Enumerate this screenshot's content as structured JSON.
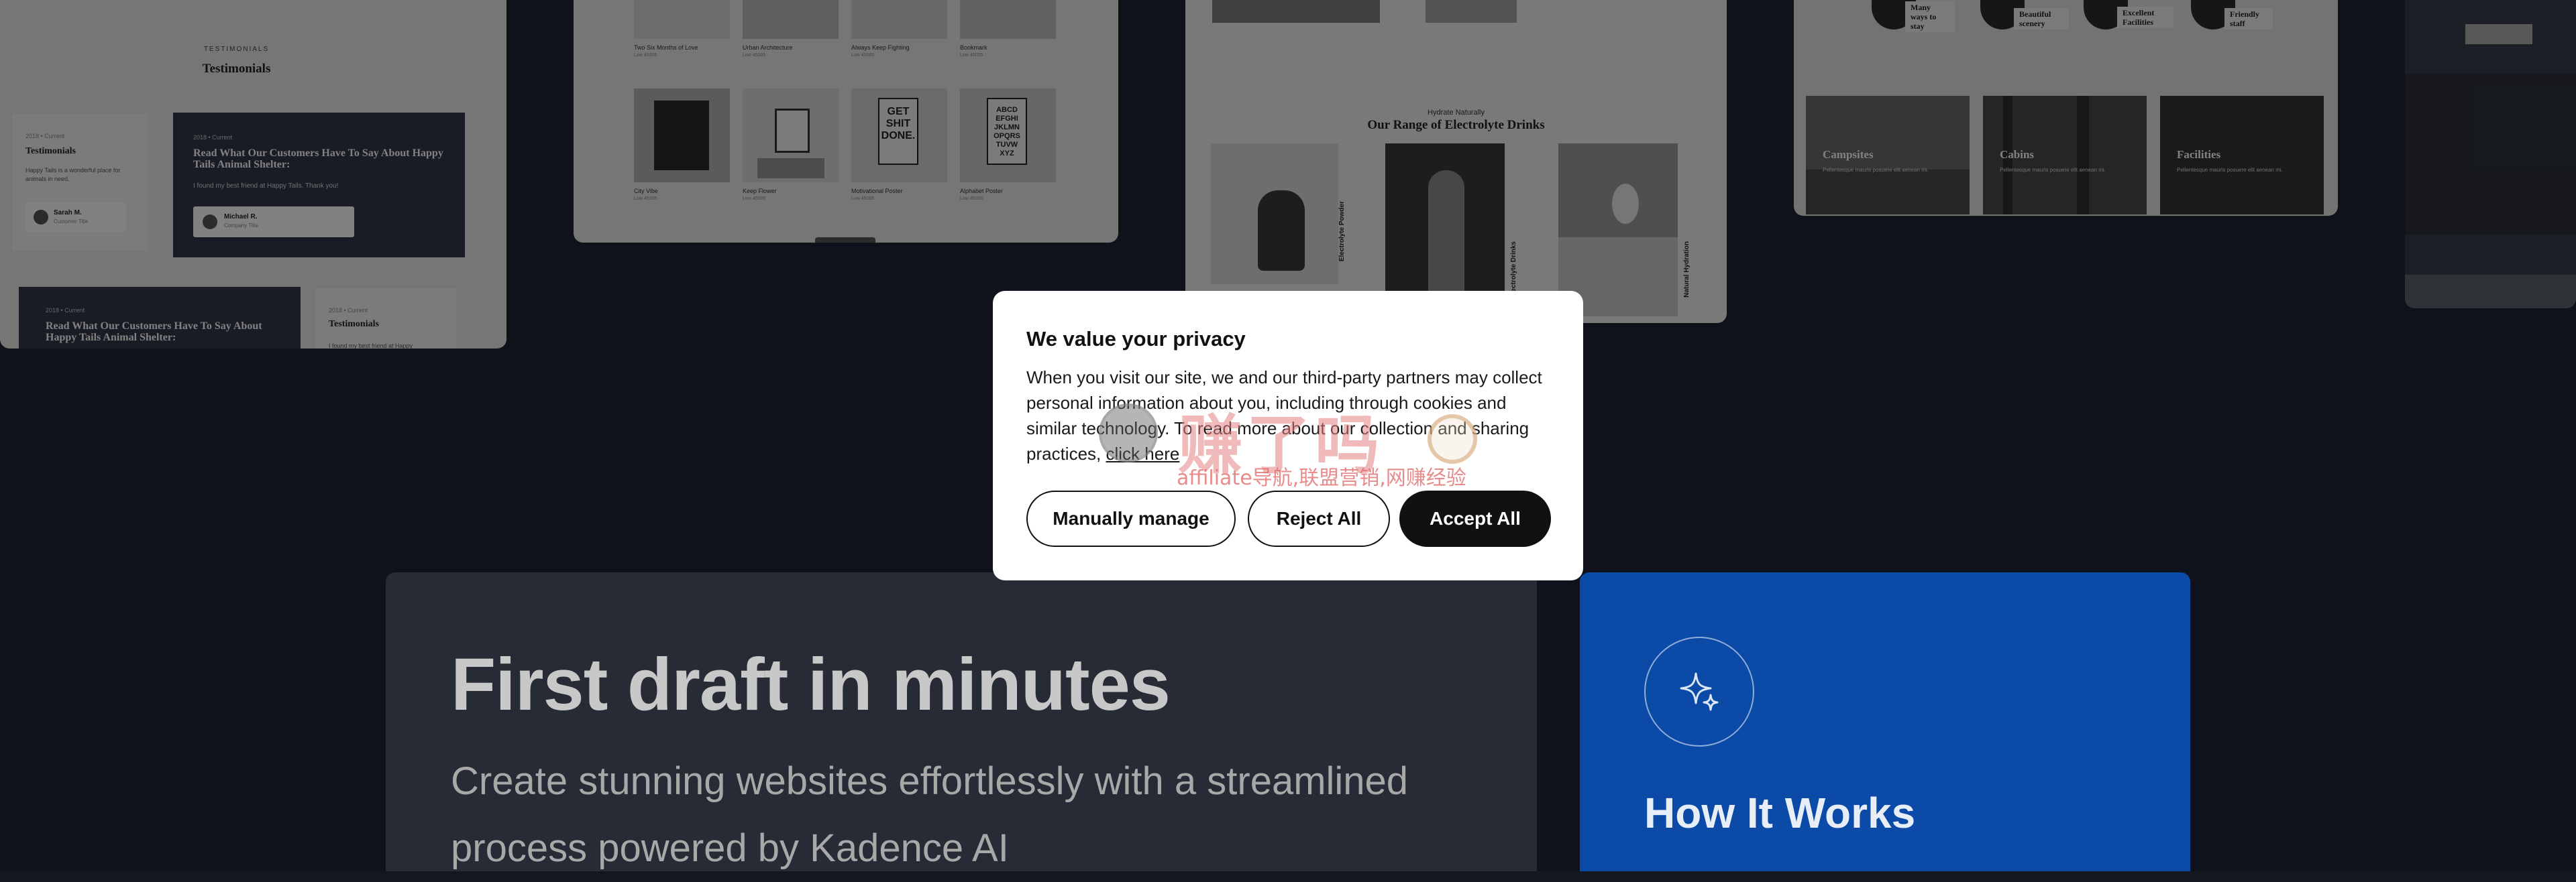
{
  "bg_cards": {
    "testimonials": {
      "eyebrow": "TESTIMONIALS",
      "title": "Testimonials",
      "card_a": {
        "meta": "2018 • Current",
        "heading": "Testimonials",
        "body": "Happy Tails is a wonderful place for animals in need.",
        "author": "Sarah M.",
        "role": "Customer Title"
      },
      "card_b": {
        "meta": "2018 • Current",
        "heading": "Read What Our Customers Have To Say About Happy Tails Animal Shelter:",
        "body": "I found my best friend at Happy Tails. Thank you!",
        "author": "Michael R.",
        "role": "Company Title"
      },
      "card_c": {
        "meta": "2018 • Current",
        "heading": "Read What Our Customers Have To Say About Happy Tails Animal Shelter:"
      },
      "card_d": {
        "meta": "2018 • Current",
        "heading": "Testimonials",
        "body": "I found my best friend at Happy"
      }
    },
    "shop": {
      "top_row": [
        {
          "name": "Two Six Months of Love",
          "price": "Low 45005"
        },
        {
          "name": "Urban Architecture",
          "price": "Low 45005"
        },
        {
          "name": "Always Keep Fighting",
          "price": "Low 45005"
        },
        {
          "name": "Bookmark",
          "price": "Low 45005"
        }
      ],
      "bottom_row": [
        {
          "name": "City Vibe",
          "price": "Low 45005"
        },
        {
          "name": "Keep Flower",
          "price": "Low 45005"
        },
        {
          "name": "Motivational Poster",
          "price": "Low 45005"
        },
        {
          "name": "Alphabet Poster",
          "price": "Low 45005"
        }
      ],
      "poster_a": "GET SHIT DONE.",
      "poster_b": "ABCD EFGHI JKLMN OPQRS TUVW XYZ"
    },
    "drinks": {
      "eyebrow": "Hydrate Naturally",
      "title": "Our Range of Electrolyte Drinks",
      "labels": [
        "Electrolyte Powder",
        "Electrolyte Drinks",
        "Natural Hydration"
      ]
    },
    "camping": {
      "features": [
        "Many ways to stay",
        "Beautiful scenery",
        "Excellent Facilities",
        "Friendly staff"
      ],
      "pics": [
        {
          "label": "Campsites",
          "text": "Pellentesque mauris posuere elit aenean mi."
        },
        {
          "label": "Cabins",
          "text": "Pellentesque mauris posuere elit aenean mi."
        },
        {
          "label": "Facilities",
          "text": "Pellentesque mauris posuere elit aenean mi."
        }
      ]
    }
  },
  "consent": {
    "title": "We value your privacy",
    "body": "When you visit our site, we and our third-party partners may collect personal information about you, including through cookies and similar technology. To read more about our collection and sharing practices,",
    "link_text": "click here",
    "buttons": {
      "manage": "Manually manage",
      "reject": "Reject All",
      "accept": "Accept All"
    }
  },
  "watermark": {
    "chinese": "赚了吗",
    "tagline": "affiliate导航,联盟营销,网赚经验"
  },
  "hero": {
    "heading": "First draft in minutes",
    "subheading": "Create stunning websites effortlessly with a streamlined process powered by Kadence AI"
  },
  "how_it_works": {
    "title": "How It Works",
    "icon": "sparkle-icon"
  },
  "colors": {
    "page_bg": "#131720",
    "dark_panel": "#262b35",
    "blue_panel": "#0b4aa7",
    "accent_button": "#111111"
  }
}
